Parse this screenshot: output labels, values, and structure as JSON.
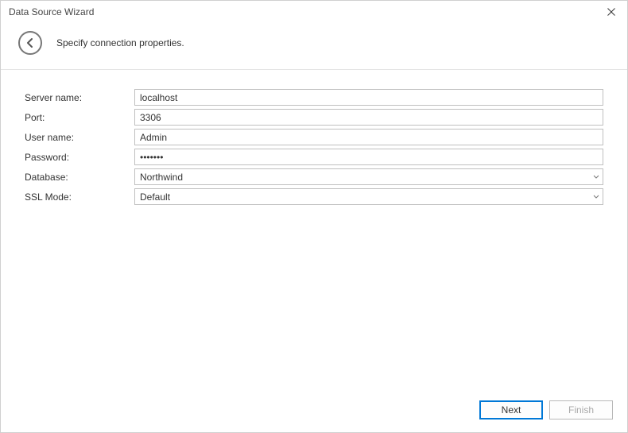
{
  "title": "Data Source Wizard",
  "subtitle": "Specify connection properties.",
  "fields": {
    "server_name": {
      "label": "Server name:",
      "value": "localhost"
    },
    "port": {
      "label": "Port:",
      "value": "3306"
    },
    "user_name": {
      "label": "User name:",
      "value": "Admin"
    },
    "password": {
      "label": "Password:",
      "value": "•••••••"
    },
    "database": {
      "label": "Database:",
      "value": "Northwind"
    },
    "ssl_mode": {
      "label": "SSL Mode:",
      "value": "Default"
    }
  },
  "buttons": {
    "next": "Next",
    "finish": "Finish"
  }
}
